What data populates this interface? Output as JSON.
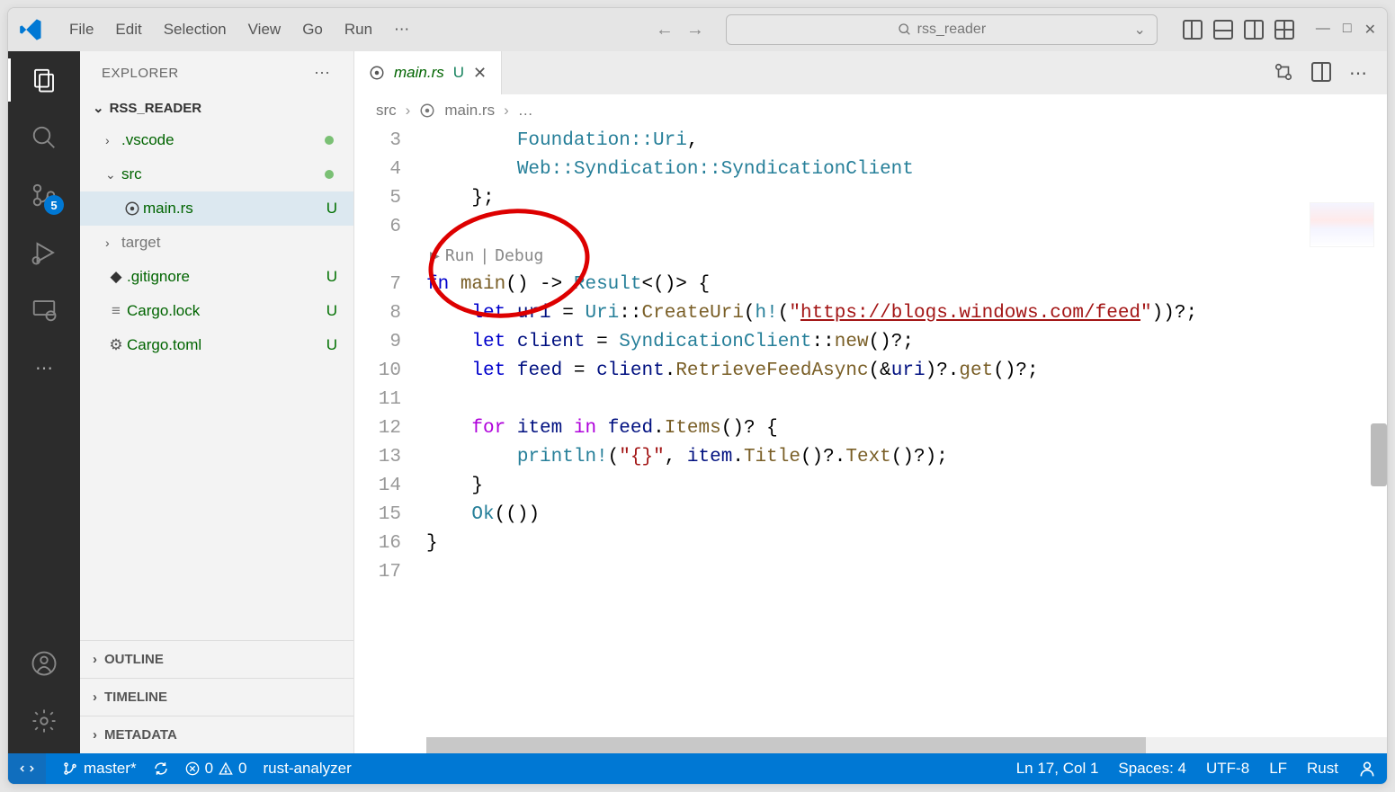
{
  "titlebar": {
    "menu": {
      "file": "File",
      "edit": "Edit",
      "selection": "Selection",
      "view": "View",
      "go": "Go",
      "run": "Run"
    },
    "search_text": "rss_reader"
  },
  "sidebar": {
    "title": "EXPLORER",
    "project": "RSS_READER",
    "tree": {
      "vscode": ".vscode",
      "src": "src",
      "main": "main.rs",
      "main_status": "U",
      "target": "target",
      "gitignore": ".gitignore",
      "gitignore_status": "U",
      "cargolock": "Cargo.lock",
      "cargolock_status": "U",
      "cargotoml": "Cargo.toml",
      "cargotoml_status": "U"
    },
    "sections": {
      "outline": "OUTLINE",
      "timeline": "TIMELINE",
      "metadata": "METADATA"
    }
  },
  "activity": {
    "scm_badge": "5"
  },
  "editor": {
    "tab": {
      "name": "main.rs",
      "status": "U"
    },
    "breadcrumb": {
      "src": "src",
      "file": "main.rs",
      "more": "…"
    },
    "codelens": {
      "run": "Run",
      "debug": "Debug"
    },
    "lines": {
      "n3": "3",
      "n4": "4",
      "n5": "5",
      "n6": "6",
      "n7": "7",
      "n8": "8",
      "n9": "9",
      "n10": "10",
      "n11": "11",
      "n12": "12",
      "n13": "13",
      "n14": "14",
      "n15": "15",
      "n16": "16",
      "n17": "17"
    },
    "code": {
      "l3_a": "        Foundation::",
      "l3_b": "Uri",
      "l3_c": ",",
      "l4_a": "        Web::Syndication::",
      "l4_b": "SyndicationClient",
      "l5": "    };",
      "l7_a": "fn ",
      "l7_b": "main",
      "l7_c": "() -> ",
      "l7_d": "Result",
      "l7_e": "<()> {",
      "l8_a": "    ",
      "l8_b": "let ",
      "l8_c": "uri",
      "l8_d": " = ",
      "l8_e": "Uri",
      "l8_f": "::",
      "l8_g": "CreateUri",
      "l8_h": "(",
      "l8_i": "h!",
      "l8_j": "(",
      "l8_k": "\"",
      "l8_l": "https://blogs.windows.com/feed",
      "l8_m": "\"",
      "l8_n": "))?;",
      "l9_a": "    ",
      "l9_b": "let ",
      "l9_c": "client",
      "l9_d": " = ",
      "l9_e": "SyndicationClient",
      "l9_f": "::",
      "l9_g": "new",
      "l9_h": "()?;",
      "l10_a": "    ",
      "l10_b": "let ",
      "l10_c": "feed",
      "l10_d": " = ",
      "l10_e": "client",
      "l10_f": ".",
      "l10_g": "RetrieveFeedAsync",
      "l10_h": "(&",
      "l10_i": "uri",
      "l10_j": ")?.",
      "l10_k": "get",
      "l10_l": "()?;",
      "l12_a": "    ",
      "l12_b": "for ",
      "l12_c": "item",
      "l12_d": " in ",
      "l12_e": "feed",
      "l12_f": ".",
      "l12_g": "Items",
      "l12_h": "()? {",
      "l13_a": "        ",
      "l13_b": "println!",
      "l13_c": "(",
      "l13_d": "\"{}\"",
      "l13_e": ", ",
      "l13_f": "item",
      "l13_g": ".",
      "l13_h": "Title",
      "l13_i": "()?.",
      "l13_j": "Text",
      "l13_k": "()?);",
      "l14": "    }",
      "l15_a": "    ",
      "l15_b": "Ok",
      "l15_c": "(())",
      "l16": "}"
    }
  },
  "statusbar": {
    "branch": "master*",
    "errors": "0",
    "warnings": "0",
    "analyzer": "rust-analyzer",
    "position": "Ln 17, Col 1",
    "spaces": "Spaces: 4",
    "encoding": "UTF-8",
    "eol": "LF",
    "lang": "Rust"
  }
}
